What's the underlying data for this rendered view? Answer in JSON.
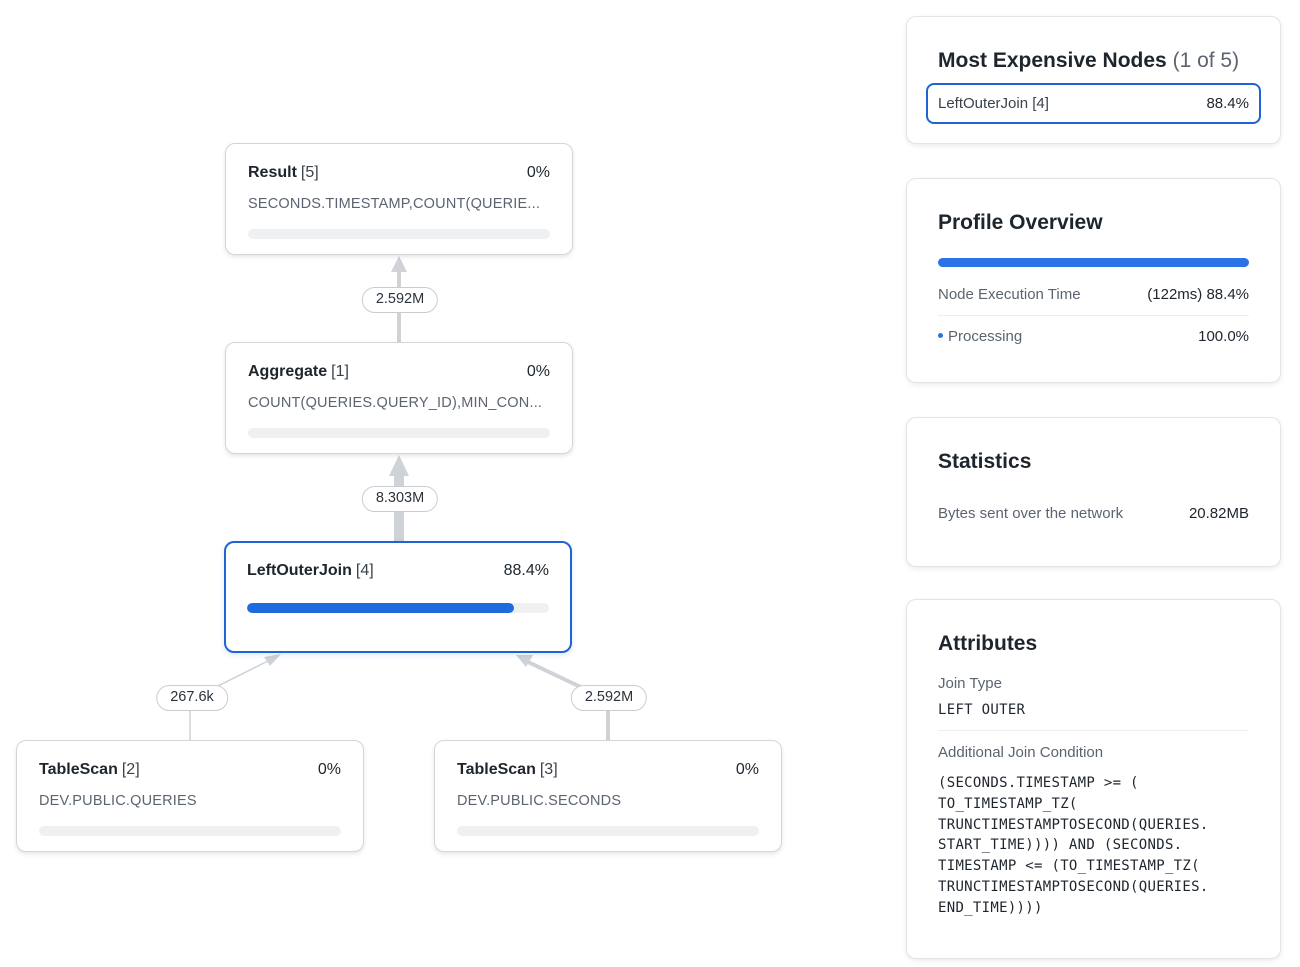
{
  "graph": {
    "nodes": [
      {
        "name": "Result",
        "index": "[5]",
        "percent": "0%",
        "detail": "SECONDS.TIMESTAMP,COUNT(QUERIE...",
        "fill": 0
      },
      {
        "name": "Aggregate",
        "index": "[1]",
        "percent": "0%",
        "detail": "COUNT(QUERIES.QUERY_ID),MIN_CON...",
        "fill": 0
      },
      {
        "name": "LeftOuterJoin",
        "index": "[4]",
        "percent": "88.4%",
        "fill": 0.884
      },
      {
        "name": "TableScan",
        "index": "[2]",
        "percent": "0%",
        "detail": "DEV.PUBLIC.QUERIES",
        "fill": 0
      },
      {
        "name": "TableScan",
        "index": "[3]",
        "percent": "0%",
        "detail": "DEV.PUBLIC.SECONDS",
        "fill": 0
      }
    ],
    "edges": [
      {
        "label": "2.592M"
      },
      {
        "label": "8.303M"
      },
      {
        "label": "267.6k"
      },
      {
        "label": "2.592M"
      }
    ],
    "colors": {
      "accent": "#1e64d2",
      "edge": "#cfd2d6"
    }
  },
  "expensive": {
    "title": "Most Expensive Nodes",
    "count": "(1 of 5)",
    "item_label": "LeftOuterJoin [4]",
    "item_value": "88.4%"
  },
  "overview": {
    "title": "Profile Overview",
    "exec_label": "Node Execution Time",
    "exec_value": "(122ms) 88.4%",
    "processing_label": "Processing",
    "processing_value": "100.0%"
  },
  "statistics": {
    "title": "Statistics",
    "bytes_label": "Bytes sent over the network",
    "bytes_value": "20.82MB"
  },
  "attributes": {
    "title": "Attributes",
    "join_type_label": "Join Type",
    "join_type_value": "LEFT OUTER",
    "condition_label": "Additional Join Condition",
    "condition_value": "(SECONDS.TIMESTAMP >= (\nTO_TIMESTAMP_TZ(\nTRUNCTIMESTAMPTOSECOND(QUERIES.\nSTART_TIME)))) AND (SECONDS.\nTIMESTAMP <= (TO_TIMESTAMP_TZ(\nTRUNCTIMESTAMPTOSECOND(QUERIES.\nEND_TIME))))"
  }
}
